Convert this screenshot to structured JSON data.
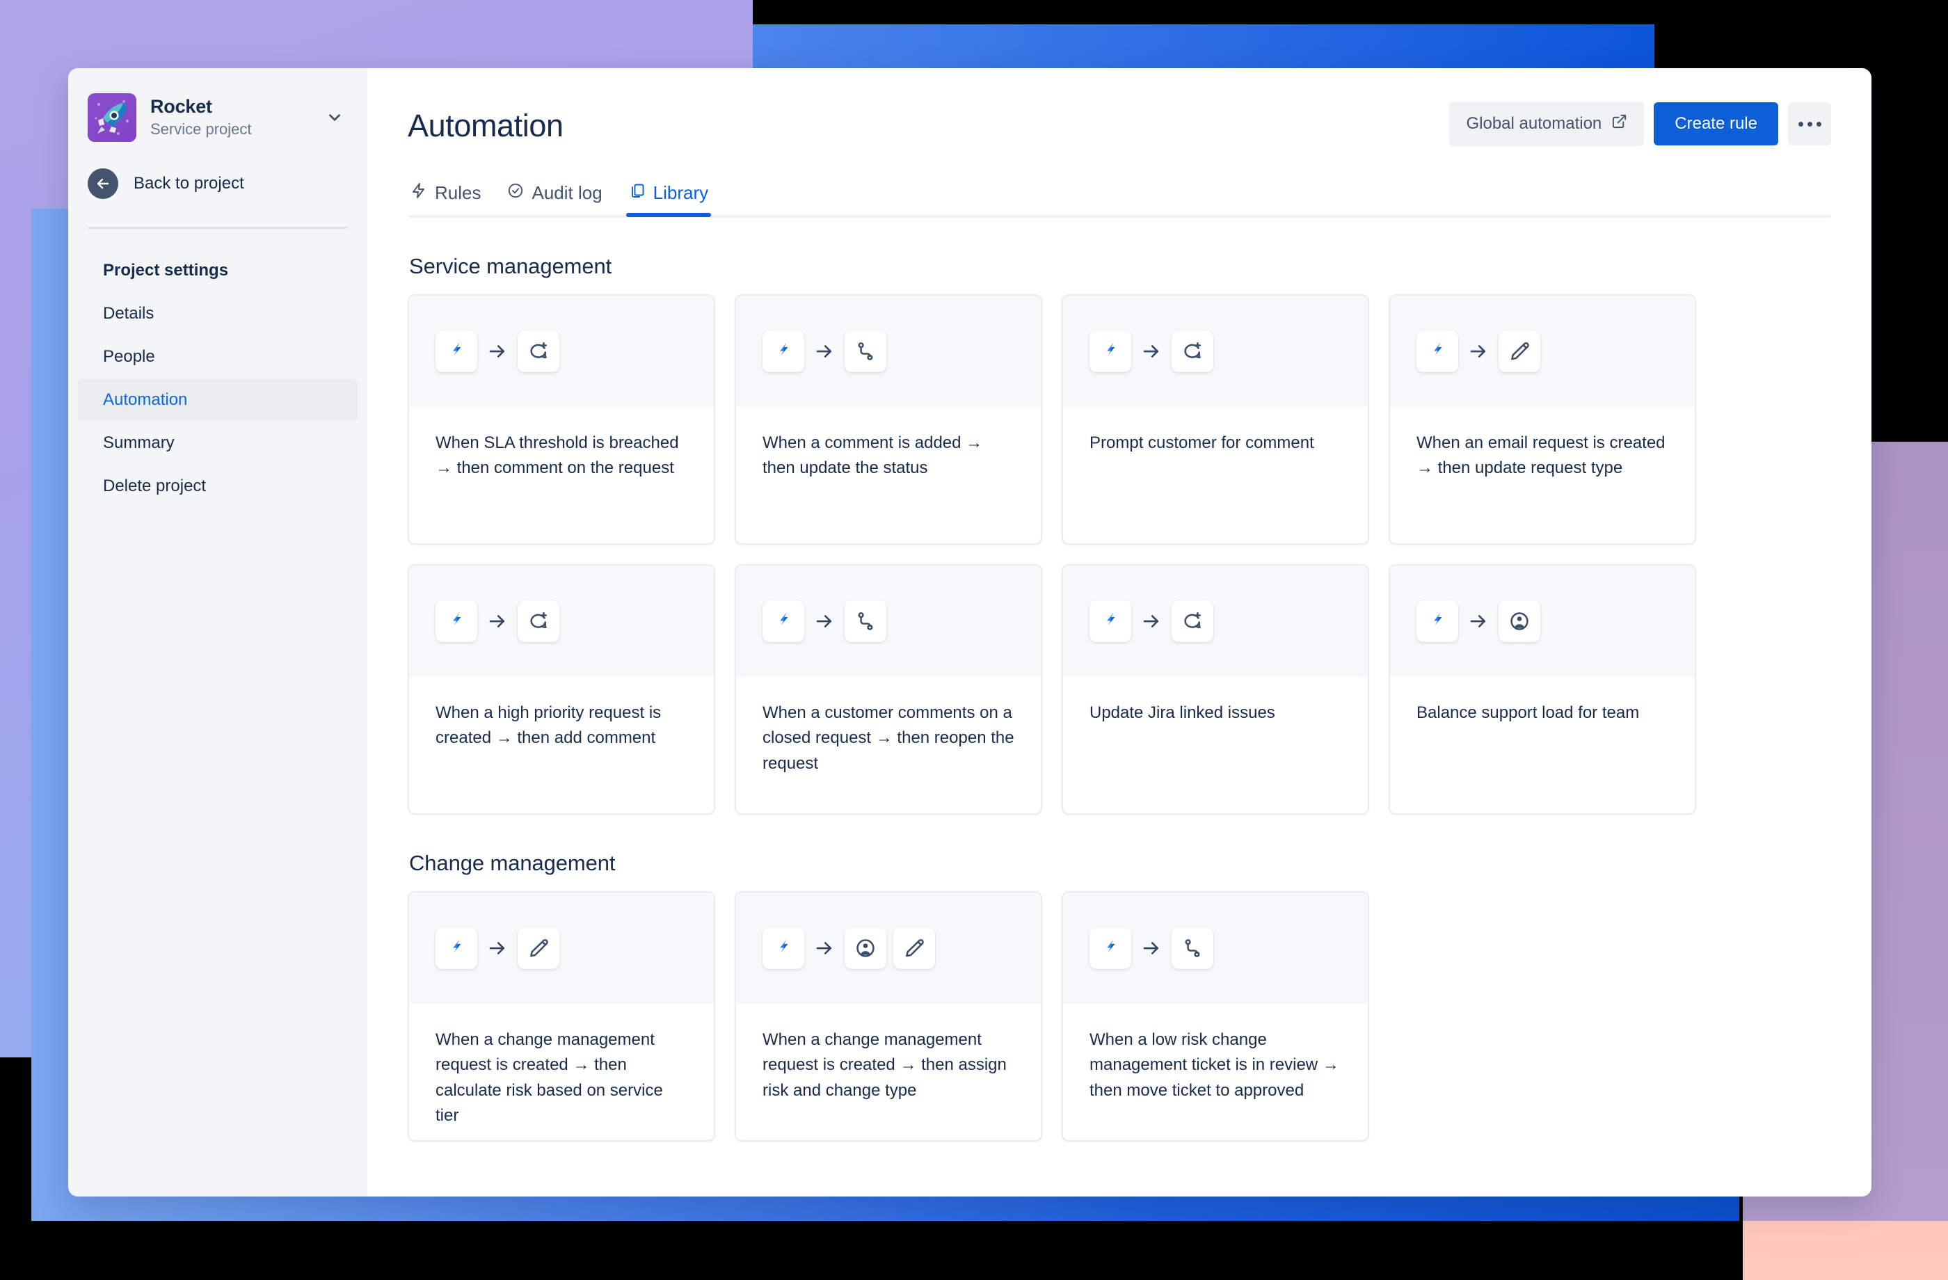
{
  "window": {
    "title": "Automation"
  },
  "sidebar": {
    "project": {
      "name": "Rocket",
      "type": "Service project",
      "avatar_icon": "rocket-icon",
      "chevron_icon": "chevron-down-icon"
    },
    "back": {
      "label": "Back to project",
      "icon": "arrow-left-circle-icon"
    },
    "items": [
      {
        "label": "Project settings",
        "active": false,
        "bold": true
      },
      {
        "label": "Details",
        "active": false,
        "bold": false
      },
      {
        "label": "People",
        "active": false,
        "bold": false
      },
      {
        "label": "Automation",
        "active": true,
        "bold": false
      },
      {
        "label": "Summary",
        "active": false,
        "bold": false
      },
      {
        "label": "Delete project",
        "active": false,
        "bold": false
      }
    ]
  },
  "header": {
    "title": "Automation",
    "global_automation_label": "Global automation",
    "global_automation_icon": "external-link-icon",
    "create_rule_label": "Create rule",
    "more_actions_icon": "more-horizontal-icon"
  },
  "tabs": [
    {
      "label": "Rules",
      "icon": "lightning-bolt-icon",
      "active": false
    },
    {
      "label": "Audit log",
      "icon": "check-circle-icon",
      "active": false
    },
    {
      "label": "Library",
      "icon": "copy-icon",
      "active": true
    }
  ],
  "colors": {
    "accent_blue": "#0c5fd6",
    "link_blue": "#0c66e4",
    "text_dark": "#172b4d",
    "text_muted": "#6b778c",
    "sidebar_bg": "#f4f5f7",
    "card_header_bg": "#f7f8fa",
    "card_border": "#ebecf0"
  },
  "sections": [
    {
      "title": "Service management",
      "cards": [
        {
          "text": "When SLA threshold is breached → then comment on the request",
          "icons": [
            "jira-bolt-icon",
            "arrow-right-icon",
            "comment-add-icon"
          ]
        },
        {
          "text": "When a comment is added → then update the status",
          "icons": [
            "jira-bolt-icon",
            "arrow-right-icon",
            "transition-icon"
          ]
        },
        {
          "text": "Prompt customer for comment",
          "icons": [
            "jira-bolt-icon",
            "arrow-right-icon",
            "comment-add-icon"
          ]
        },
        {
          "text": "When an email request is created → then update request type",
          "icons": [
            "jira-bolt-icon",
            "arrow-right-icon",
            "edit-pencil-icon"
          ]
        },
        {
          "text": "When a high priority request is created → then add comment",
          "icons": [
            "jira-bolt-icon",
            "arrow-right-icon",
            "comment-add-icon"
          ]
        },
        {
          "text": "When a customer comments on a closed request → then reopen the request",
          "icons": [
            "jira-bolt-icon",
            "arrow-right-icon",
            "transition-icon"
          ]
        },
        {
          "text": "Update Jira linked issues",
          "icons": [
            "jira-bolt-icon",
            "arrow-right-icon",
            "comment-add-icon"
          ]
        },
        {
          "text": "Balance support load for team",
          "icons": [
            "jira-bolt-icon",
            "arrow-right-icon",
            "person-assign-icon"
          ]
        }
      ]
    },
    {
      "title": "Change management",
      "cards": [
        {
          "text": "When a change management request is created → then calculate risk based on service tier",
          "icons": [
            "jira-bolt-icon",
            "arrow-right-icon",
            "edit-pencil-icon"
          ]
        },
        {
          "text": "When a change management request is created → then assign risk and change type",
          "icons": [
            "jira-bolt-icon",
            "arrow-right-icon",
            "person-assign-icon",
            "edit-pencil-icon"
          ]
        },
        {
          "text": "When a low risk change management ticket is in review → then move ticket to approved",
          "icons": [
            "jira-bolt-icon",
            "arrow-right-icon",
            "transition-icon"
          ]
        }
      ]
    }
  ]
}
